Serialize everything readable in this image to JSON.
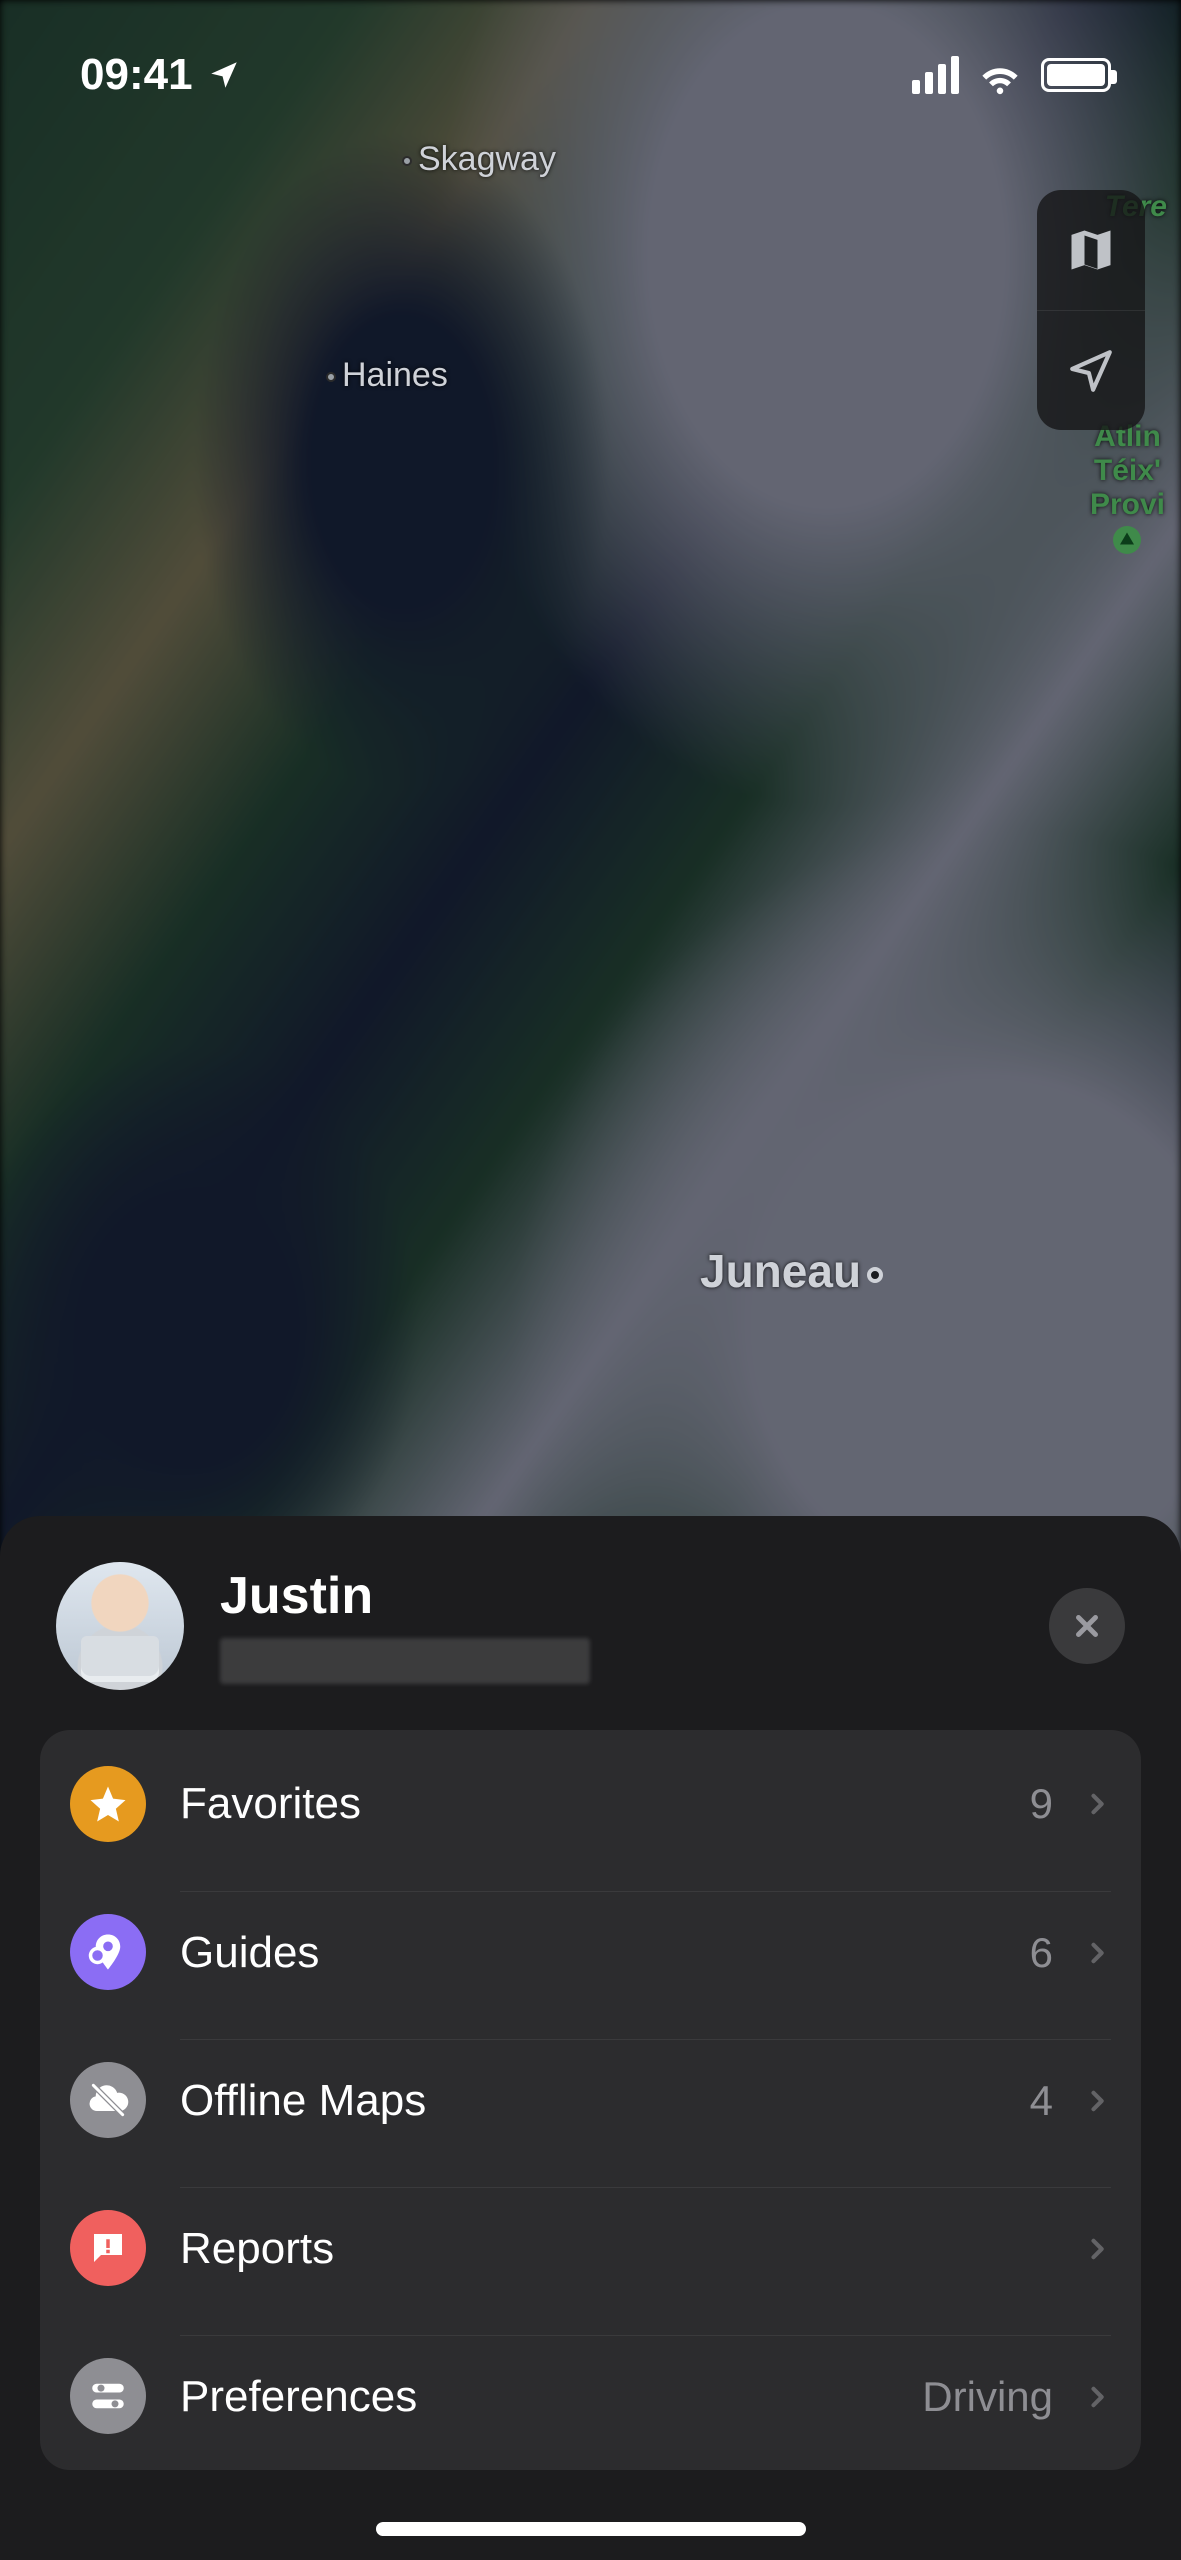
{
  "status": {
    "time": "09:41"
  },
  "map": {
    "labels": {
      "skagway": "Skagway",
      "haines": "Haines",
      "juneau": "Juneau",
      "atlin_park": "Atlin\nTéix'\nProvi",
      "tere": "Tere"
    }
  },
  "profile": {
    "name": "Justin"
  },
  "menu": {
    "items": [
      {
        "key": "favorites",
        "label": "Favorites",
        "value": "9",
        "iconBg": "bg-orange"
      },
      {
        "key": "guides",
        "label": "Guides",
        "value": "6",
        "iconBg": "bg-purple"
      },
      {
        "key": "offline",
        "label": "Offline Maps",
        "value": "4",
        "iconBg": "bg-gray"
      },
      {
        "key": "reports",
        "label": "Reports",
        "value": "",
        "iconBg": "bg-red"
      },
      {
        "key": "preferences",
        "label": "Preferences",
        "value": "Driving",
        "iconBg": "bg-gray"
      }
    ]
  }
}
